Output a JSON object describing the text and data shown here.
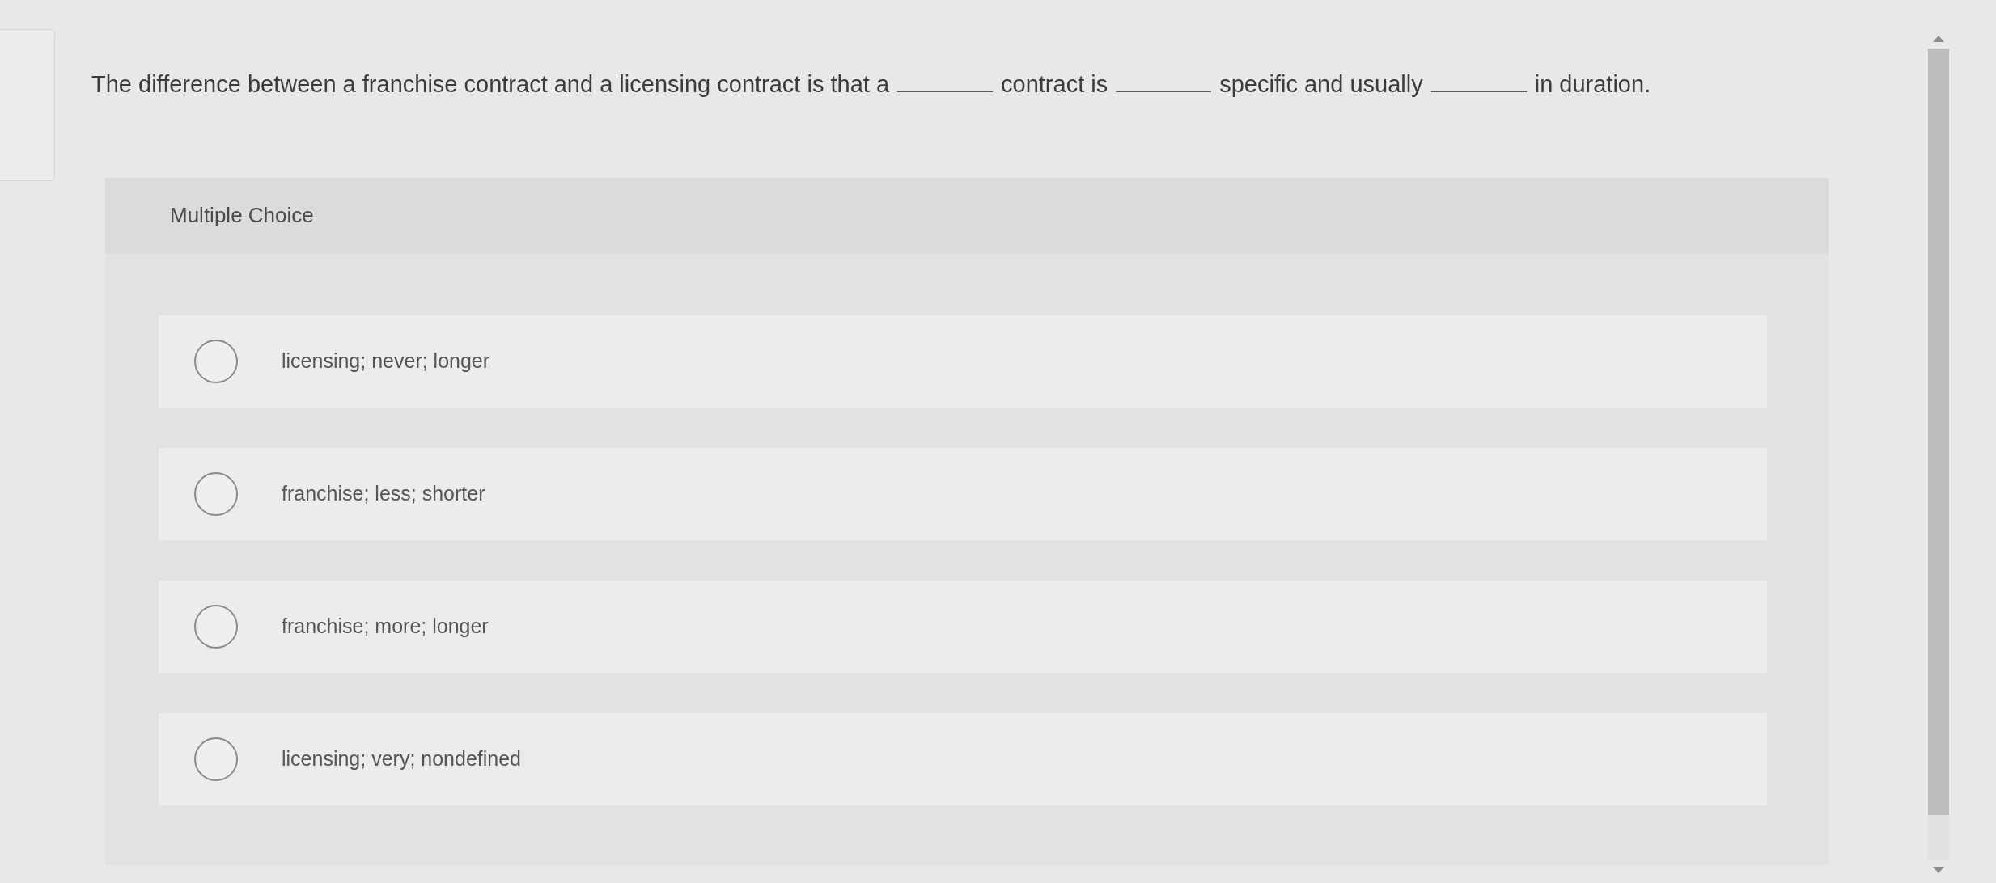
{
  "question": {
    "parts": [
      {
        "kind": "text",
        "text": "The difference between a franchise contract and a licensing contract is that a"
      },
      {
        "kind": "blank"
      },
      {
        "kind": "text",
        "text": "contract is"
      },
      {
        "kind": "blank"
      },
      {
        "kind": "text",
        "text": "specific and usually"
      },
      {
        "kind": "blank"
      },
      {
        "kind": "text",
        "text": "in duration."
      }
    ]
  },
  "answer_panel": {
    "type_label": "Multiple Choice",
    "choices": [
      {
        "text": "licensing; never; longer",
        "selected": false
      },
      {
        "text": "franchise; less; shorter",
        "selected": false
      },
      {
        "text": "franchise; more; longer",
        "selected": false
      },
      {
        "text": "licensing; very; nondefined",
        "selected": false
      }
    ]
  }
}
